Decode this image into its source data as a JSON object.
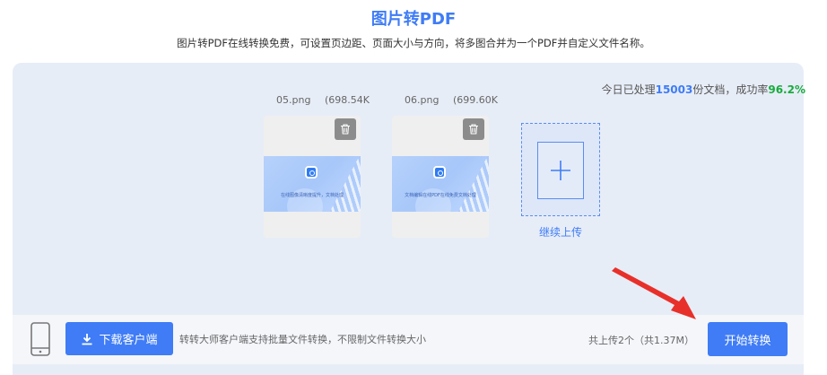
{
  "header": {
    "title": "图片转PDF",
    "subtitle": "图片转PDF在线转换免费，可设置页边距、页面大小与方向，将多图合并为一个PDF并自定义文件名称。"
  },
  "stats": {
    "prefix": "今日已处理",
    "count": "15003",
    "middle": "份文档，成功率",
    "rate": "96.2%"
  },
  "files": [
    {
      "name": "05.png",
      "size": "(698.54K",
      "caption": "在线图像清晰度提升，文档处理"
    },
    {
      "name": "06.png",
      "size": "(699.60K",
      "caption": "文档编辑在线PDF在线免费文档处理"
    }
  ],
  "add": {
    "label": "继续上传"
  },
  "footer": {
    "download_label": "下载客户端",
    "client_note": "转转大师客户端支持批量文件转换，不限制文件转换大小",
    "summary": "共上传2个（共1.37M）",
    "start_label": "开始转换"
  },
  "colors": {
    "accent": "#3f7cf6",
    "success": "#1aab3f",
    "annotation_arrow": "#e8302a"
  },
  "icons": [
    "trash-icon",
    "plus-icon",
    "download-icon",
    "phone-icon",
    "arrow-annotation"
  ]
}
